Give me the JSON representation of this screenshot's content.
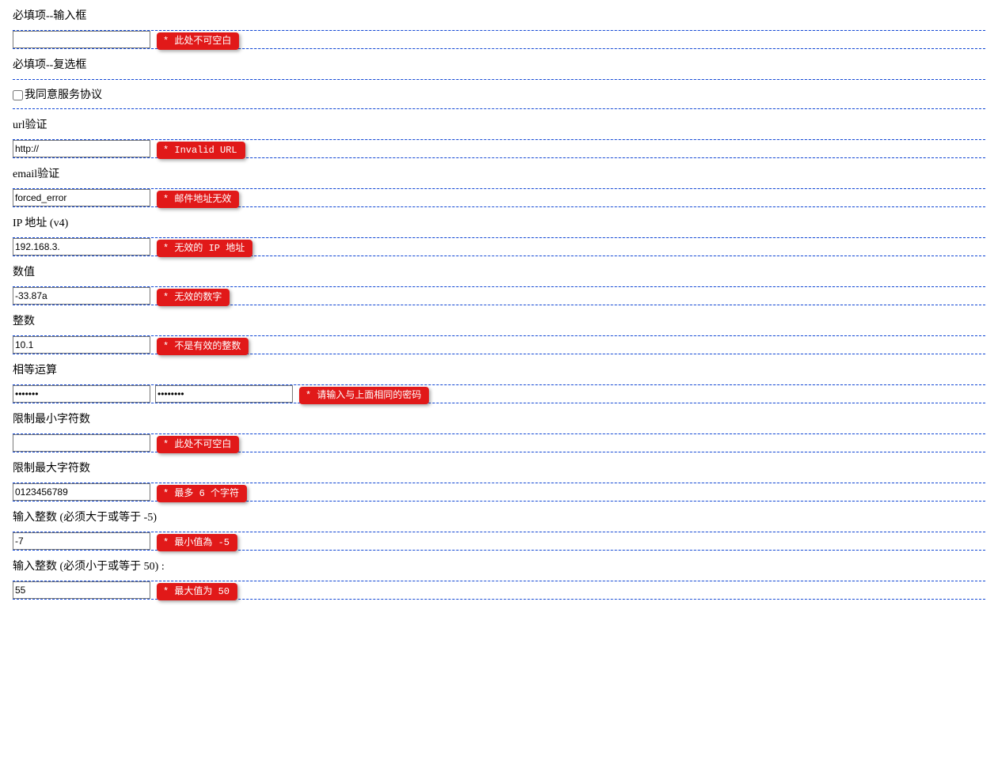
{
  "rows": [
    {
      "label": "必填项--输入框",
      "fields": [
        {
          "type": "text",
          "value": ""
        }
      ],
      "error": "* 此处不可空白"
    },
    {
      "label": "必填项--复选框",
      "checkbox": {
        "text": "我同意服务协议"
      }
    },
    {
      "label": "url验证",
      "fields": [
        {
          "type": "text",
          "value": "http://"
        }
      ],
      "error": "* Invalid URL"
    },
    {
      "label": "email验证",
      "fields": [
        {
          "type": "text",
          "value": "forced_error"
        }
      ],
      "error": "* 邮件地址无效"
    },
    {
      "label": "IP 地址 (v4)",
      "fields": [
        {
          "type": "text",
          "value": "192.168.3."
        }
      ],
      "error": "* 无效的 IP 地址"
    },
    {
      "label": "数值",
      "fields": [
        {
          "type": "text",
          "value": "-33.87a"
        }
      ],
      "error": "* 无效的数字"
    },
    {
      "label": "整数",
      "fields": [
        {
          "type": "text",
          "value": "10.1"
        }
      ],
      "error": "* 不是有效的整数"
    },
    {
      "label": "相等运算",
      "fields": [
        {
          "type": "password",
          "value": "1234567"
        },
        {
          "type": "password",
          "value": "12345678"
        }
      ],
      "error": "* 请输入与上面相同的密码"
    },
    {
      "label": "限制最小字符数",
      "fields": [
        {
          "type": "text",
          "value": ""
        }
      ],
      "error": "* 此处不可空白"
    },
    {
      "label": "限制最大字符数",
      "fields": [
        {
          "type": "text",
          "value": "0123456789"
        }
      ],
      "error": "* 最多 6 个字符"
    },
    {
      "label": "输入整数 (必须大于或等于 -5)",
      "fields": [
        {
          "type": "text",
          "value": "-7"
        }
      ],
      "error": "* 最小值為 -5"
    },
    {
      "label": "输入整数 (必须小于或等于 50) :",
      "fields": [
        {
          "type": "text",
          "value": "55"
        }
      ],
      "error": "* 最大值为 50"
    }
  ]
}
